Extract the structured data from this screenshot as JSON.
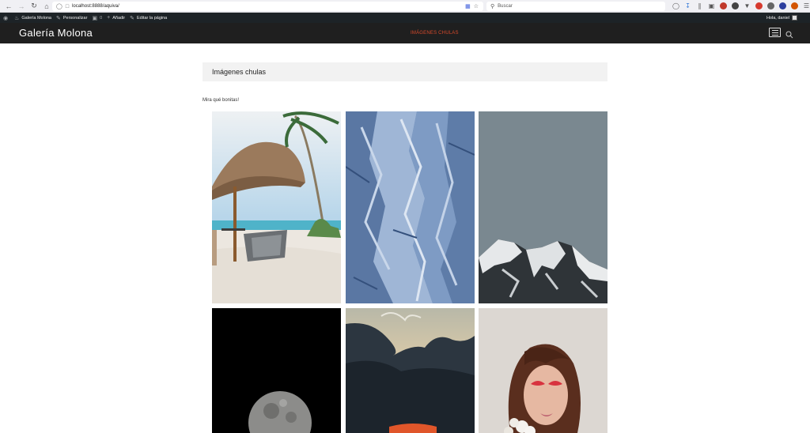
{
  "browser": {
    "url": "localhost:8888/aquiva/",
    "search_placeholder": "Buscar",
    "back_icon": "arrow-left-icon",
    "forward_icon": "arrow-right-icon",
    "reload_icon": "reload-icon",
    "home_icon": "home-icon"
  },
  "admin_bar": {
    "site_name": "Galería Molona",
    "customize": "Personalizar",
    "comments_count": "0",
    "add_new": "Añadir",
    "edit_page": "Editar la página",
    "greeting": "Hola, daniel"
  },
  "header": {
    "site_title": "Galería Molona",
    "menu_item": "IMÁGENES CHULAS"
  },
  "content": {
    "page_title": "Imágenes chulas",
    "intro_text": "Mira qué bonitas!"
  },
  "gallery": {
    "images": [
      {
        "name": "beach-umbrella-image",
        "alt": "Beach with straw umbrella and loungers"
      },
      {
        "name": "blue-ice-texture-image",
        "alt": "Blue textured rock/ice"
      },
      {
        "name": "snowy-mountain-image",
        "alt": "Snowy mountain peak under gray sky"
      },
      {
        "name": "moon-image",
        "alt": "Moon on black background"
      },
      {
        "name": "storm-clouds-sunset-image",
        "alt": "Dark storm clouds at sunset"
      },
      {
        "name": "woman-portrait-image",
        "alt": "Woman with red eye makeup and flowers"
      }
    ]
  },
  "colors": {
    "header_bg": "#1f1f1f",
    "menu_accent": "#d94a2b",
    "admin_bg": "#1d2327"
  }
}
